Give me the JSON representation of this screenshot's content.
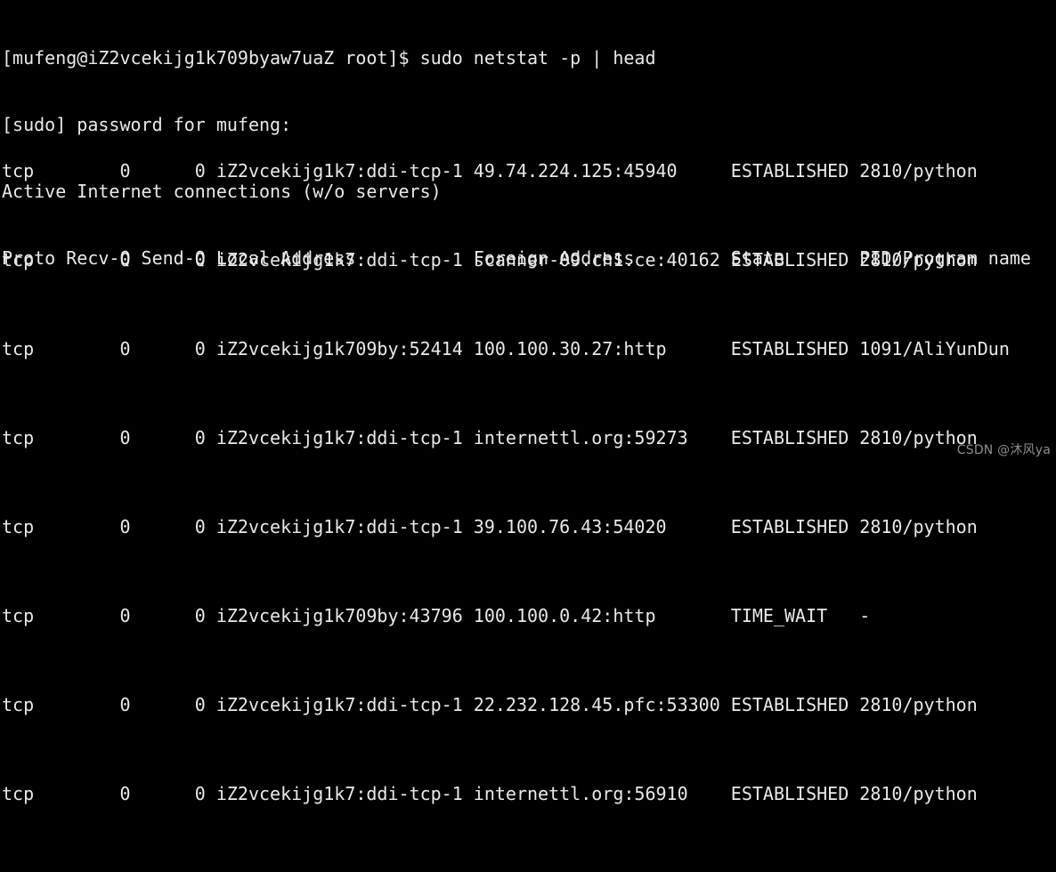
{
  "terminal": {
    "background_color": "#000000",
    "text_color": "#e9e9e9",
    "prompt_line": "[mufeng@iZ2vcekijg1k709byaw7uaZ root]$ sudo netstat -p | head",
    "sudo_password_prompt": "[sudo] password for mufeng:",
    "banner": "Active Internet connections (w/o servers)",
    "column_header": "Proto Recv-Q Send-Q Local Address           Foreign Address         State       PID/Program name",
    "columns": {
      "proto": "Proto",
      "recv_q": "Recv-Q",
      "send_q": "Send-Q",
      "local_address": "Local Address",
      "foreign_address": "Foreign Address",
      "state": "State",
      "pid_program": "PID/Program name"
    },
    "rows": [
      {
        "line": "tcp        0      0 iZ2vcekijg1k7:ddi-tcp-1 49.74.224.125:45940     ESTABLISHED 2810/python",
        "proto": "tcp",
        "recv_q": "0",
        "send_q": "0",
        "local_address": "iZ2vcekijg1k7:ddi-tcp-1",
        "foreign_address": "49.74.224.125:45940",
        "state": "ESTABLISHED",
        "pid_program": "2810/python"
      },
      {
        "line": "tcp        0      0 iZ2vcekijg1k7:ddi-tcp-1 scanner-09.ch1.ce:40162 ESTABLISHED 2810/python",
        "proto": "tcp",
        "recv_q": "0",
        "send_q": "0",
        "local_address": "iZ2vcekijg1k7:ddi-tcp-1",
        "foreign_address": "scanner-09.ch1.ce:40162",
        "state": "ESTABLISHED",
        "pid_program": "2810/python"
      },
      {
        "line": "tcp        0      0 iZ2vcekijg1k709by:52414 100.100.30.27:http      ESTABLISHED 1091/AliYunDun",
        "proto": "tcp",
        "recv_q": "0",
        "send_q": "0",
        "local_address": "iZ2vcekijg1k709by:52414",
        "foreign_address": "100.100.30.27:http",
        "state": "ESTABLISHED",
        "pid_program": "1091/AliYunDun"
      },
      {
        "line": "tcp        0      0 iZ2vcekijg1k7:ddi-tcp-1 internettl.org:59273    ESTABLISHED 2810/python",
        "proto": "tcp",
        "recv_q": "0",
        "send_q": "0",
        "local_address": "iZ2vcekijg1k7:ddi-tcp-1",
        "foreign_address": "internettl.org:59273",
        "state": "ESTABLISHED",
        "pid_program": "2810/python"
      },
      {
        "line": "tcp        0      0 iZ2vcekijg1k7:ddi-tcp-1 39.100.76.43:54020      ESTABLISHED 2810/python",
        "proto": "tcp",
        "recv_q": "0",
        "send_q": "0",
        "local_address": "iZ2vcekijg1k7:ddi-tcp-1",
        "foreign_address": "39.100.76.43:54020",
        "state": "ESTABLISHED",
        "pid_program": "2810/python"
      },
      {
        "line": "tcp        0      0 iZ2vcekijg1k709by:43796 100.100.0.42:http       TIME_WAIT   -",
        "proto": "tcp",
        "recv_q": "0",
        "send_q": "0",
        "local_address": "iZ2vcekijg1k709by:43796",
        "foreign_address": "100.100.0.42:http",
        "state": "TIME_WAIT",
        "pid_program": "-"
      },
      {
        "line": "tcp        0      0 iZ2vcekijg1k7:ddi-tcp-1 22.232.128.45.pfc:53300 ESTABLISHED 2810/python",
        "proto": "tcp",
        "recv_q": "0",
        "send_q": "0",
        "local_address": "iZ2vcekijg1k7:ddi-tcp-1",
        "foreign_address": "22.232.128.45.pfc:53300",
        "state": "ESTABLISHED",
        "pid_program": "2810/python"
      },
      {
        "line": "tcp        0      0 iZ2vcekijg1k7:ddi-tcp-1 internettl.org:56910    ESTABLISHED 2810/python",
        "proto": "tcp",
        "recv_q": "0",
        "send_q": "0",
        "local_address": "iZ2vcekijg1k7:ddi-tcp-1",
        "foreign_address": "internettl.org:56910",
        "state": "ESTABLISHED",
        "pid_program": "2810/python"
      }
    ]
  },
  "watermark": {
    "text": "CSDN @沐风ya"
  }
}
